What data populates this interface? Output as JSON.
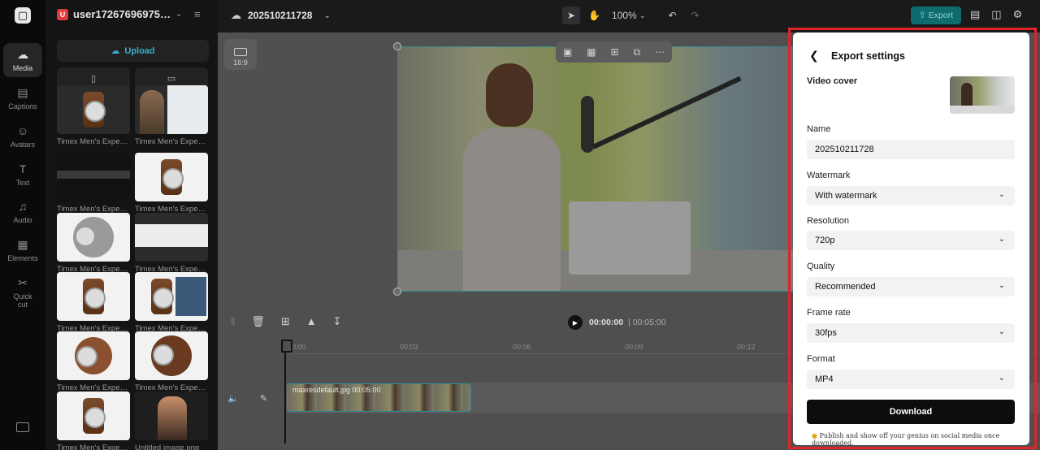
{
  "rail": {
    "items": [
      {
        "label": "Media",
        "icon": "cloud-icon"
      },
      {
        "label": "Captions",
        "icon": "captions-icon"
      },
      {
        "label": "Avatars",
        "icon": "avatar-icon"
      },
      {
        "label": "Text",
        "icon": "text-icon"
      },
      {
        "label": "Audio",
        "icon": "music-icon"
      },
      {
        "label": "Elements",
        "icon": "elements-icon"
      },
      {
        "label": "Quick cut",
        "icon": "scissors-icon"
      }
    ]
  },
  "media": {
    "user_initial": "U",
    "username": "user17267696975…",
    "upload_label": "Upload",
    "tiles": [
      {
        "caption": "Timex Men's Exped…"
      },
      {
        "caption": "Timex Men's Exped…"
      },
      {
        "caption": "Timex Men's Exped…"
      },
      {
        "caption": "Timex Men's Exped…"
      },
      {
        "caption": "Timex Men's Exped…"
      },
      {
        "caption": "Timex Men's Exped…"
      },
      {
        "caption": "Timex Men's Exped…"
      },
      {
        "caption": "Timex Men's Exped…"
      },
      {
        "caption": "Timex Men's Exped…"
      },
      {
        "caption": "Timex Men's Exped…"
      },
      {
        "caption": "Timex Men's Exped…"
      },
      {
        "caption": "Untitled image.png"
      }
    ]
  },
  "topbar": {
    "project_name": "202510211728",
    "zoom": "100%",
    "export_label": "Export"
  },
  "canvas": {
    "ratio_label": "16:9"
  },
  "timeline": {
    "current_time": "00:00:00",
    "duration": "00:05:00",
    "ruler": [
      "00:00",
      "00:03",
      "00:06",
      "00:09",
      "00:12"
    ],
    "clip_label": "maxresdefault.jpg  00:05:00"
  },
  "export_panel": {
    "title": "Export settings",
    "video_cover_label": "Video cover",
    "name_label": "Name",
    "name_value": "202510211728",
    "watermark_label": "Watermark",
    "watermark_value": "With watermark",
    "resolution_label": "Resolution",
    "resolution_value": "720p",
    "quality_label": "Quality",
    "quality_value": "Recommended",
    "framerate_label": "Frame rate",
    "framerate_value": "30fps",
    "format_label": "Format",
    "format_value": "MP4",
    "download_label": "Download",
    "hint": "Publish and show off your genius on social media once downloaded.",
    "highlight_color": "#e0242a"
  }
}
